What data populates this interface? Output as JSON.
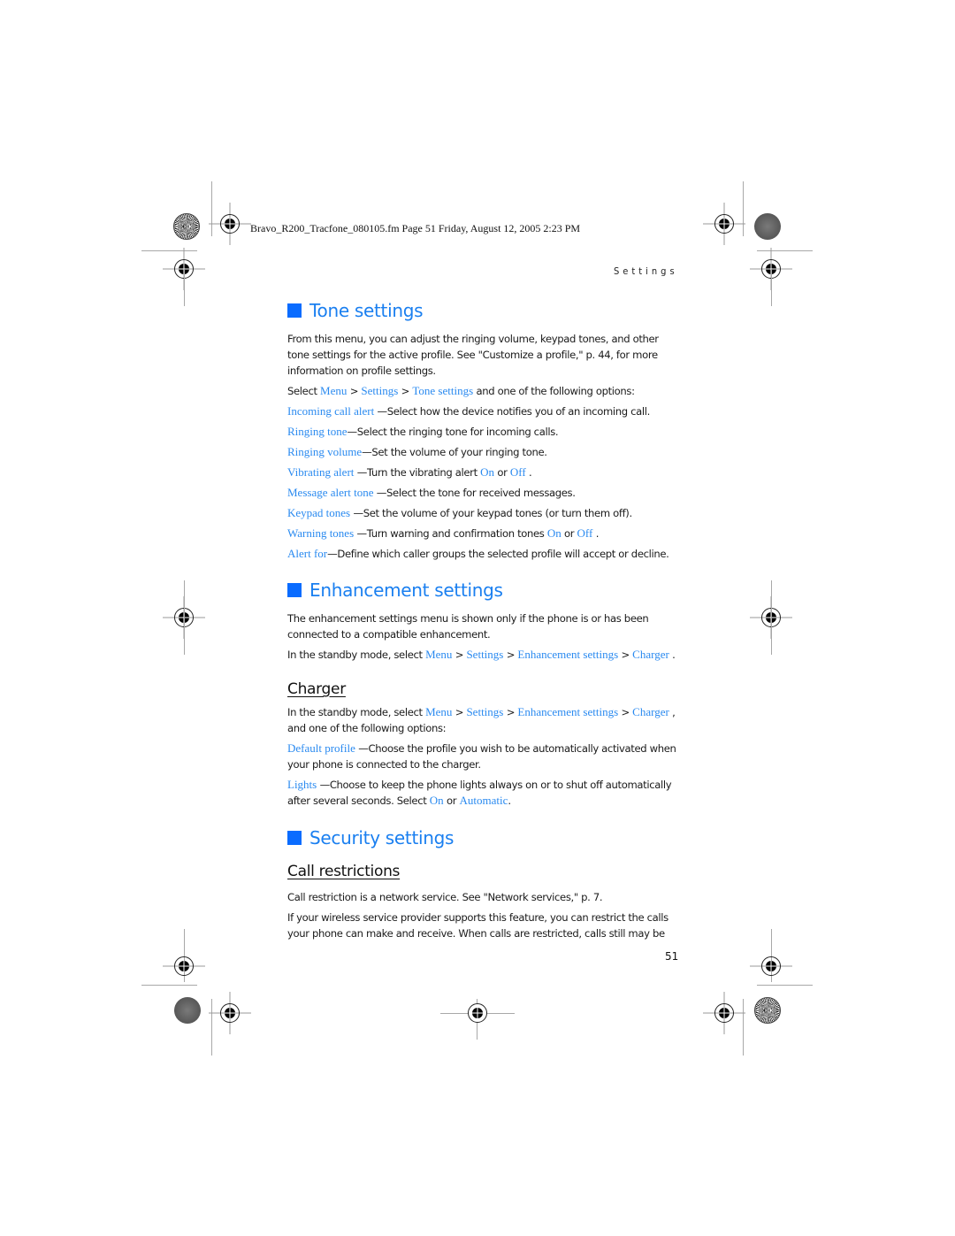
{
  "slug_line": "Bravo_R200_Tracfone_080105.fm  Page 51  Friday, August 12, 2005  2:23 PM",
  "running_head": "Settings",
  "page_number": "51",
  "tone_settings": {
    "heading": "Tone settings",
    "intro": "From this menu, you can adjust the ringing volume, keypad tones, and other tone settings for the active profile. See \"Customize a profile,\" p. 44, for more information on profile settings.",
    "select_prefix": "Select ",
    "path": [
      "Menu",
      "Settings",
      "Tone settings"
    ],
    "sep": " > ",
    "select_suffix": " and one of the following options:",
    "options": [
      {
        "term": "Incoming call alert",
        "desc": " —Select how the device notifies you of an incoming call."
      },
      {
        "term": "Ringing tone",
        "desc": "—Select the ringing tone for incoming calls."
      },
      {
        "term": "Ringing volume",
        "desc": "—Set the volume of your ringing tone."
      },
      {
        "term": "Vibrating alert",
        "desc": " —Turn the vibrating alert ",
        "on": "On",
        "or": " or ",
        "off": "Off",
        "end": " ."
      },
      {
        "term": "Message alert tone",
        "desc": " —Select the tone for received messages."
      },
      {
        "term": "Keypad tones",
        "desc": " —Set the volume of your keypad tones (or turn them off)."
      },
      {
        "term": "Warning tones",
        "desc": " —Turn warning and confirmation tones ",
        "on": "On",
        "or": " or ",
        "off": "Off",
        "end": " ."
      },
      {
        "term": "Alert for",
        "desc": "—Define which caller groups the selected profile will accept or decline."
      }
    ]
  },
  "enhancement_settings": {
    "heading": "Enhancement settings",
    "intro": "The enhancement settings menu is shown only if the phone is or has been connected to a compatible enhancement.",
    "select_prefix": "In the standby mode, select ",
    "path": [
      "Menu",
      "Settings",
      "Enhancement settings",
      "Charger"
    ],
    "sep": " > ",
    "select_suffix": " ."
  },
  "charger": {
    "heading": "Charger",
    "select_prefix": "In the standby mode, select ",
    "path": [
      "Menu",
      "Settings",
      "Enhancement settings",
      "Charger"
    ],
    "sep": " > ",
    "select_suffix": " , and one of the following options:",
    "options": [
      {
        "term": "Default profile",
        "desc": " —Choose the profile you wish to be automatically activated when your phone is connected to the charger."
      },
      {
        "term": "Lights",
        "desc": " —Choose to keep the phone lights always on or to shut off automatically after several seconds. Select ",
        "on": "On",
        "or": " or ",
        "auto": "Automatic",
        "end": "."
      }
    ]
  },
  "security_settings": {
    "heading": "Security settings"
  },
  "call_restrictions": {
    "heading": "Call restrictions",
    "para1": "Call restriction is a network service. See \"Network services,\" p. 7.",
    "para2": "If your wireless service provider supports this feature, you can restrict the calls your phone can make and receive. When calls are restricted, calls still may be"
  },
  "colors": {
    "heading_blue": "#1a7ff0",
    "bullet_blue": "#0a6cff",
    "term_blue": "#2a8af0"
  }
}
